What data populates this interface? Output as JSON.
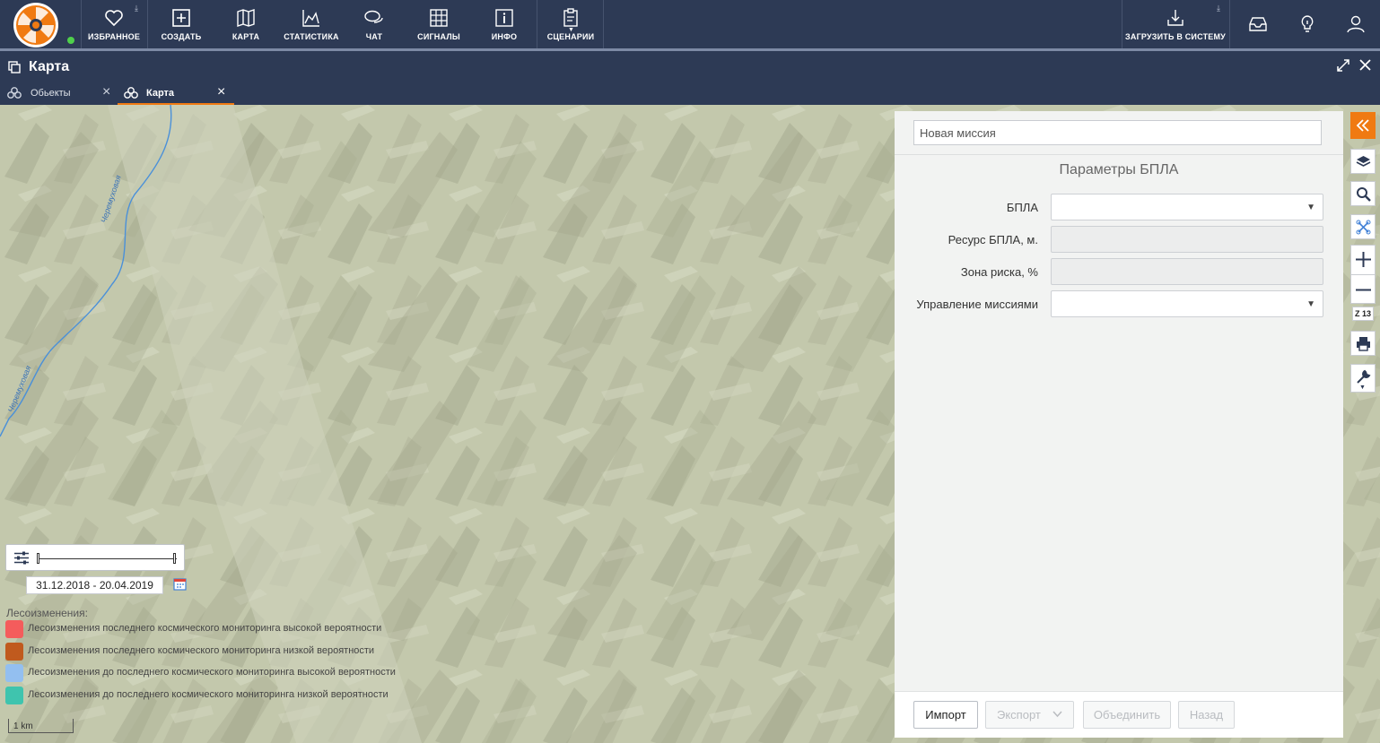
{
  "topnav": {
    "items": [
      {
        "label": "Избранное",
        "icon": "heart-icon"
      },
      {
        "label": "Создать",
        "icon": "plus-square-icon"
      },
      {
        "label": "Карта",
        "icon": "map-icon"
      },
      {
        "label": "Статистика",
        "icon": "chart-icon"
      },
      {
        "label": "Чат",
        "icon": "chat-icon"
      },
      {
        "label": "Сигналы",
        "icon": "grid-icon"
      },
      {
        "label": "Инфо",
        "icon": "info-icon"
      },
      {
        "label": "Сценарии",
        "icon": "clipboard-icon"
      }
    ],
    "upload_label": "Загрузить в систему",
    "right_icons": [
      "inbox-icon",
      "bulb-icon",
      "user-icon"
    ]
  },
  "window": {
    "title": "Карта",
    "tabs": [
      {
        "label": "Обьекты",
        "active": false
      },
      {
        "label": "Карта",
        "active": true
      }
    ]
  },
  "panel": {
    "mission_placeholder": "Новая миссия",
    "heading": "Параметры БПЛА",
    "fields": [
      {
        "label": "БПЛА",
        "type": "select",
        "value": ""
      },
      {
        "label": "Ресурс БПЛА, м.",
        "type": "readonly",
        "value": ""
      },
      {
        "label": "Зона риска, %",
        "type": "readonly",
        "value": ""
      },
      {
        "label": "Управление миссиями",
        "type": "select",
        "value": ""
      }
    ],
    "buttons": [
      {
        "label": "Импорт",
        "enabled": true
      },
      {
        "label": "Экспорт",
        "enabled": false
      },
      {
        "label": "Объединить",
        "enabled": false
      },
      {
        "label": "Назад",
        "enabled": false
      }
    ]
  },
  "map": {
    "zoom_level": "Z 13",
    "date_range": "31.12.2018 - 20.04.2019",
    "legend_title": "Лесоизменения:",
    "legend": [
      {
        "label": "Лесоизменения последнего космического мониторинга высокой вероятности",
        "color": "#f45c5c"
      },
      {
        "label": "Лесоизменения последнего космического мониторинга низкой вероятности",
        "color": "#c05a1e"
      },
      {
        "label": "Лесоизменения до последнего космического мониторинга высокой вероятности",
        "color": "#93bff0"
      },
      {
        "label": "Лесоизменения до последнего космического мониторинга низкой вероятности",
        "color": "#3fc4ae"
      }
    ],
    "scale_label": "1 km",
    "river_labels": [
      "Черемуховая",
      "Черемуховая"
    ]
  },
  "colors": {
    "nav_bg": "#2d3a55",
    "accent": "#f07a12",
    "map_bg": "#c3c8ac"
  }
}
